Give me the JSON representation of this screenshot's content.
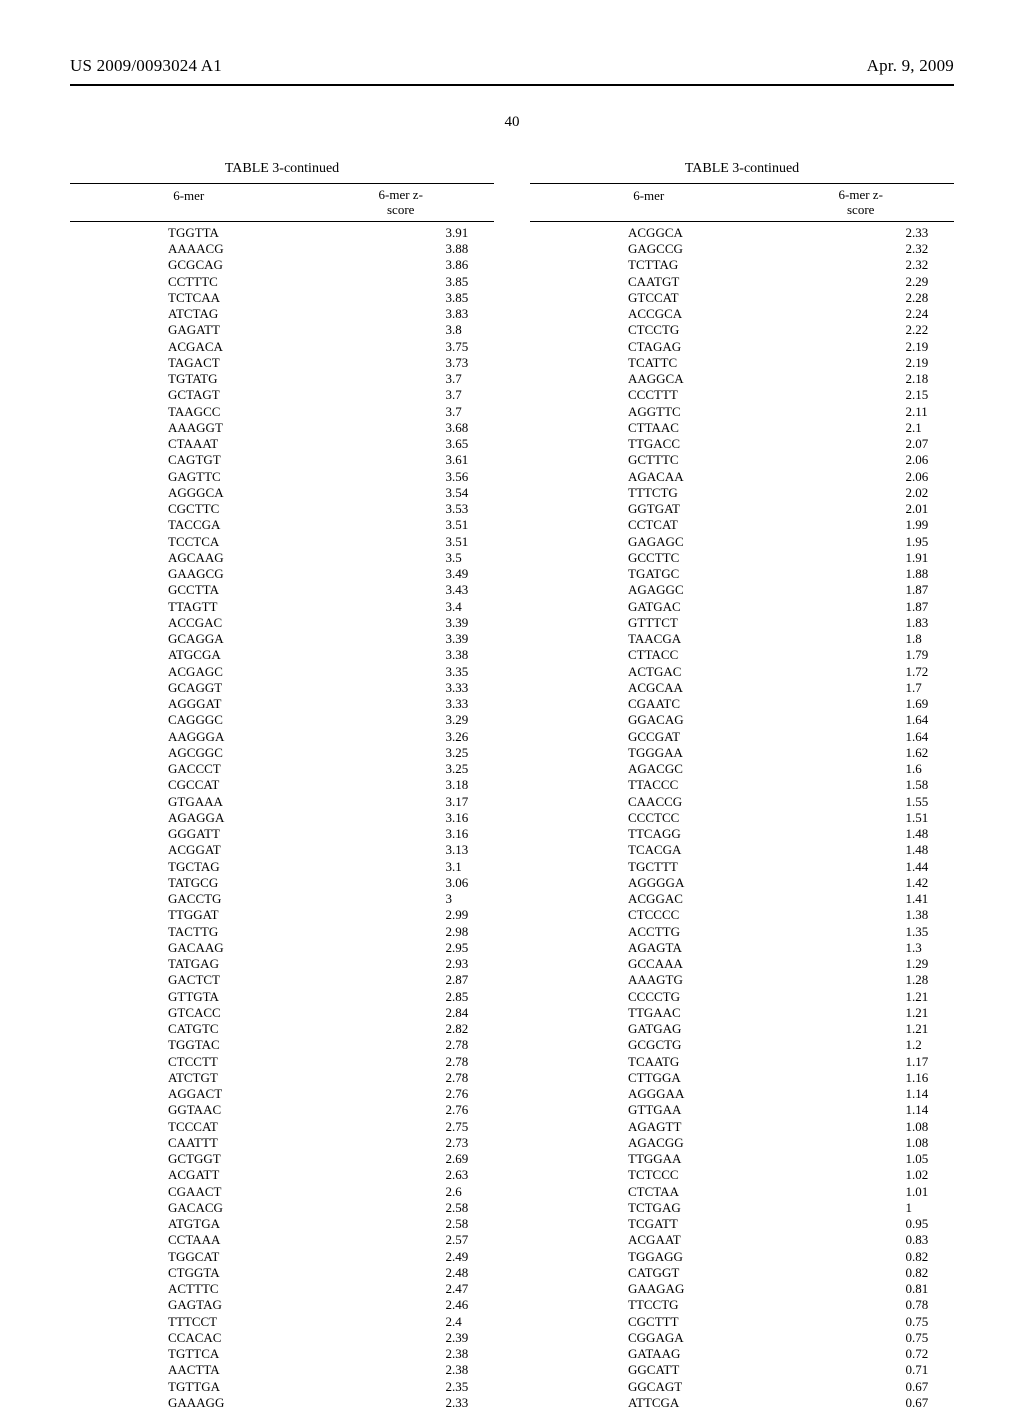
{
  "header": {
    "pub_number": "US 2009/0093024 A1",
    "pub_date": "Apr. 9, 2009"
  },
  "page_number": "40",
  "caption": "TABLE 3-continued",
  "col_header_left": "6-mer",
  "col_header_right_line1": "6-mer z-",
  "col_header_right_line2": "score",
  "left": [
    {
      "m": "TGGTTA",
      "s": "3.91"
    },
    {
      "m": "AAAACG",
      "s": "3.88"
    },
    {
      "m": "GCGCAG",
      "s": "3.86"
    },
    {
      "m": "CCTTTC",
      "s": "3.85"
    },
    {
      "m": "TCTCAA",
      "s": "3.85"
    },
    {
      "m": "ATCTAG",
      "s": "3.83"
    },
    {
      "m": "GAGATT",
      "s": "3.8"
    },
    {
      "m": "ACGACA",
      "s": "3.75"
    },
    {
      "m": "TAGACT",
      "s": "3.73"
    },
    {
      "m": "TGTATG",
      "s": "3.7"
    },
    {
      "m": "GCTAGT",
      "s": "3.7"
    },
    {
      "m": "TAAGCC",
      "s": "3.7"
    },
    {
      "m": "AAAGGT",
      "s": "3.68"
    },
    {
      "m": "CTAAAT",
      "s": "3.65"
    },
    {
      "m": "CAGTGT",
      "s": "3.61"
    },
    {
      "m": "GAGTTC",
      "s": "3.56"
    },
    {
      "m": "AGGGCA",
      "s": "3.54"
    },
    {
      "m": "CGCTTC",
      "s": "3.53"
    },
    {
      "m": "TACCGA",
      "s": "3.51"
    },
    {
      "m": "TCCTCA",
      "s": "3.51"
    },
    {
      "m": "AGCAAG",
      "s": "3.5"
    },
    {
      "m": "GAAGCG",
      "s": "3.49"
    },
    {
      "m": "GCCTTA",
      "s": "3.43"
    },
    {
      "m": "TTAGTT",
      "s": "3.4"
    },
    {
      "m": "ACCGAC",
      "s": "3.39"
    },
    {
      "m": "GCAGGA",
      "s": "3.39"
    },
    {
      "m": "ATGCGA",
      "s": "3.38"
    },
    {
      "m": "ACGAGC",
      "s": "3.35"
    },
    {
      "m": "GCAGGT",
      "s": "3.33"
    },
    {
      "m": "AGGGAT",
      "s": "3.33"
    },
    {
      "m": "CAGGGC",
      "s": "3.29"
    },
    {
      "m": "AAGGGA",
      "s": "3.26"
    },
    {
      "m": "AGCGGC",
      "s": "3.25"
    },
    {
      "m": "GACCCT",
      "s": "3.25"
    },
    {
      "m": "CGCCAT",
      "s": "3.18"
    },
    {
      "m": "GTGAAA",
      "s": "3.17"
    },
    {
      "m": "AGAGGA",
      "s": "3.16"
    },
    {
      "m": "GGGATT",
      "s": "3.16"
    },
    {
      "m": "ACGGAT",
      "s": "3.13"
    },
    {
      "m": "TGCTAG",
      "s": "3.1"
    },
    {
      "m": "TATGCG",
      "s": "3.06"
    },
    {
      "m": "GACCTG",
      "s": "3"
    },
    {
      "m": "TTGGAT",
      "s": "2.99"
    },
    {
      "m": "TACTTG",
      "s": "2.98"
    },
    {
      "m": "GACAAG",
      "s": "2.95"
    },
    {
      "m": "TATGAG",
      "s": "2.93"
    },
    {
      "m": "GACTCT",
      "s": "2.87"
    },
    {
      "m": "GTTGTA",
      "s": "2.85"
    },
    {
      "m": "GTCACC",
      "s": "2.84"
    },
    {
      "m": "CATGTC",
      "s": "2.82"
    },
    {
      "m": "TGGTAC",
      "s": "2.78"
    },
    {
      "m": "CTCCTT",
      "s": "2.78"
    },
    {
      "m": "ATCTGT",
      "s": "2.78"
    },
    {
      "m": "AGGACT",
      "s": "2.76"
    },
    {
      "m": "GGTAAC",
      "s": "2.76"
    },
    {
      "m": "TCCCAT",
      "s": "2.75"
    },
    {
      "m": "CAATTT",
      "s": "2.73"
    },
    {
      "m": "GCTGGT",
      "s": "2.69"
    },
    {
      "m": "ACGATT",
      "s": "2.63"
    },
    {
      "m": "CGAACT",
      "s": "2.6"
    },
    {
      "m": "GACACG",
      "s": "2.58"
    },
    {
      "m": "ATGTGA",
      "s": "2.58"
    },
    {
      "m": "CCTAAA",
      "s": "2.57"
    },
    {
      "m": "TGGCAT",
      "s": "2.49"
    },
    {
      "m": "CTGGTA",
      "s": "2.48"
    },
    {
      "m": "ACTTTC",
      "s": "2.47"
    },
    {
      "m": "GAGTAG",
      "s": "2.46"
    },
    {
      "m": "TTTCCT",
      "s": "2.4"
    },
    {
      "m": "CCACAC",
      "s": "2.39"
    },
    {
      "m": "TGTTCA",
      "s": "2.38"
    },
    {
      "m": "AACTTA",
      "s": "2.38"
    },
    {
      "m": "TGTTGA",
      "s": "2.35"
    },
    {
      "m": "GAAAGG",
      "s": "2.33"
    }
  ],
  "right": [
    {
      "m": "ACGGCA",
      "s": "2.33"
    },
    {
      "m": "GAGCCG",
      "s": "2.32"
    },
    {
      "m": "TCTTAG",
      "s": "2.32"
    },
    {
      "m": "CAATGT",
      "s": "2.29"
    },
    {
      "m": "GTCCAT",
      "s": "2.28"
    },
    {
      "m": "ACCGCA",
      "s": "2.24"
    },
    {
      "m": "CTCCTG",
      "s": "2.22"
    },
    {
      "m": "CTAGAG",
      "s": "2.19"
    },
    {
      "m": "TCATTC",
      "s": "2.19"
    },
    {
      "m": "AAGGCA",
      "s": "2.18"
    },
    {
      "m": "CCCTTT",
      "s": "2.15"
    },
    {
      "m": "AGGTTC",
      "s": "2.11"
    },
    {
      "m": "CTTAAC",
      "s": "2.1"
    },
    {
      "m": "TTGACC",
      "s": "2.07"
    },
    {
      "m": "GCTTTC",
      "s": "2.06"
    },
    {
      "m": "AGACAA",
      "s": "2.06"
    },
    {
      "m": "TTTCTG",
      "s": "2.02"
    },
    {
      "m": "GGTGAT",
      "s": "2.01"
    },
    {
      "m": "CCTCAT",
      "s": "1.99"
    },
    {
      "m": "GAGAGC",
      "s": "1.95"
    },
    {
      "m": "GCCTTC",
      "s": "1.91"
    },
    {
      "m": "TGATGC",
      "s": "1.88"
    },
    {
      "m": "AGAGGC",
      "s": "1.87"
    },
    {
      "m": "GATGAC",
      "s": "1.87"
    },
    {
      "m": "GTTTCT",
      "s": "1.83"
    },
    {
      "m": "TAACGA",
      "s": "1.8"
    },
    {
      "m": "CTTACC",
      "s": "1.79"
    },
    {
      "m": "ACTGAC",
      "s": "1.72"
    },
    {
      "m": "ACGCAA",
      "s": "1.7"
    },
    {
      "m": "CGAATC",
      "s": "1.69"
    },
    {
      "m": "GGACAG",
      "s": "1.64"
    },
    {
      "m": "GCCGAT",
      "s": "1.64"
    },
    {
      "m": "TGGGAA",
      "s": "1.62"
    },
    {
      "m": "AGACGC",
      "s": "1.6"
    },
    {
      "m": "TTACCC",
      "s": "1.58"
    },
    {
      "m": "CAACCG",
      "s": "1.55"
    },
    {
      "m": "CCCTCC",
      "s": "1.51"
    },
    {
      "m": "TTCAGG",
      "s": "1.48"
    },
    {
      "m": "TCACGA",
      "s": "1.48"
    },
    {
      "m": "TGCTTT",
      "s": "1.44"
    },
    {
      "m": "AGGGGA",
      "s": "1.42"
    },
    {
      "m": "ACGGAC",
      "s": "1.41"
    },
    {
      "m": "CTCCCC",
      "s": "1.38"
    },
    {
      "m": "ACCTTG",
      "s": "1.35"
    },
    {
      "m": "AGAGTA",
      "s": "1.3"
    },
    {
      "m": "GCCAAA",
      "s": "1.29"
    },
    {
      "m": "AAAGTG",
      "s": "1.28"
    },
    {
      "m": "CCCCTG",
      "s": "1.21"
    },
    {
      "m": "TTGAAC",
      "s": "1.21"
    },
    {
      "m": "GATGAG",
      "s": "1.21"
    },
    {
      "m": "GCGCTG",
      "s": "1.2"
    },
    {
      "m": "TCAATG",
      "s": "1.17"
    },
    {
      "m": "CTTGGA",
      "s": "1.16"
    },
    {
      "m": "AGGGAA",
      "s": "1.14"
    },
    {
      "m": "GTTGAA",
      "s": "1.14"
    },
    {
      "m": "AGAGTT",
      "s": "1.08"
    },
    {
      "m": "AGACGG",
      "s": "1.08"
    },
    {
      "m": "TTGGAA",
      "s": "1.05"
    },
    {
      "m": "TCTCCC",
      "s": "1.02"
    },
    {
      "m": "CTCTAA",
      "s": "1.01"
    },
    {
      "m": "TCTGAG",
      "s": "1"
    },
    {
      "m": "TCGATT",
      "s": "0.95"
    },
    {
      "m": "ACGAAT",
      "s": "0.83"
    },
    {
      "m": "TGGAGG",
      "s": "0.82"
    },
    {
      "m": "CATGGT",
      "s": "0.82"
    },
    {
      "m": "GAAGAG",
      "s": "0.81"
    },
    {
      "m": "TTCCTG",
      "s": "0.78"
    },
    {
      "m": "CGCTTT",
      "s": "0.75"
    },
    {
      "m": "CGGAGA",
      "s": "0.75"
    },
    {
      "m": "GATAAG",
      "s": "0.72"
    },
    {
      "m": "GGCATT",
      "s": "0.71"
    },
    {
      "m": "GGCAGT",
      "s": "0.67"
    },
    {
      "m": "ATTCGA",
      "s": "0.67"
    }
  ]
}
